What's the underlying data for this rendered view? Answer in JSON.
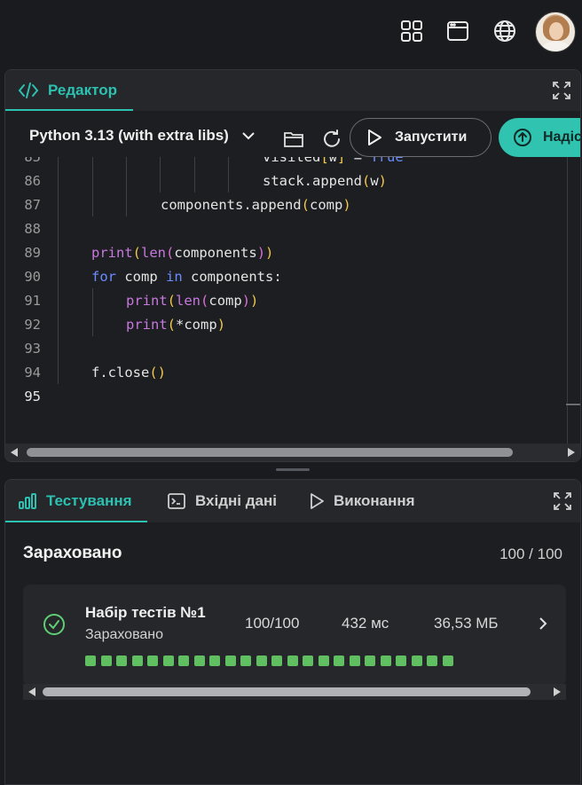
{
  "topbar": {
    "icons": [
      "grid-icon",
      "browser-window-icon",
      "globe-icon"
    ],
    "avatar_alt": "user-avatar"
  },
  "editor": {
    "tab_label": "Редактор",
    "language": "Python 3.13 (with extra libs)",
    "run_label": "Запустити",
    "submit_label": "Надіс",
    "lines": [
      {
        "n": "85",
        "text": "visited[w] = True"
      },
      {
        "n": "86",
        "text": "stack.append(w)"
      },
      {
        "n": "87",
        "text": "components.append(comp)"
      },
      {
        "n": "88",
        "text": ""
      },
      {
        "n": "89",
        "text": "print(len(components))"
      },
      {
        "n": "90",
        "text": "for comp in components:"
      },
      {
        "n": "91",
        "text": "print(len(comp))"
      },
      {
        "n": "92",
        "text": "print(*comp)"
      },
      {
        "n": "93",
        "text": ""
      },
      {
        "n": "94",
        "text": "f.close()"
      },
      {
        "n": "95",
        "text": ""
      }
    ]
  },
  "bottom": {
    "tabs": [
      {
        "label": "Тестування",
        "icon": "chart-bars-icon",
        "active": true
      },
      {
        "label": "Вхідні дані",
        "icon": "terminal-icon",
        "active": false
      },
      {
        "label": "Виконання",
        "icon": "play-icon",
        "active": false
      }
    ],
    "result_title": "Зараховано",
    "result_score": "100 / 100",
    "test": {
      "name": "Набір тестів №1",
      "status": "Зараховано",
      "score": "100/100",
      "time": "432 мс",
      "memory": "36,53 МБ",
      "passed_count": 24
    }
  },
  "colors": {
    "accent": "#2cc1b0",
    "success": "#5fbf61",
    "keyword": "#6b8cff",
    "builtin": "#c678dd",
    "bracket": "#f2c94c"
  }
}
